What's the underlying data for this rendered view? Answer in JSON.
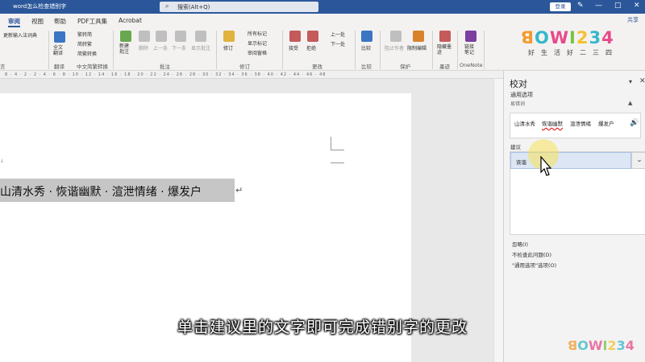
{
  "app": {
    "doc_title": "word怎么检查错别字",
    "search_placeholder": "搜索(Alt+Q)",
    "login": "登录",
    "share": "共享"
  },
  "tabs": [
    "审阅",
    "视图",
    "帮助",
    "PDF工具集",
    "Acrobat"
  ],
  "ribbon": {
    "partial_left": "更新输入法词典",
    "partial_left_label": "言",
    "translate_btn": "全文翻译",
    "trad_simp_1": "繁转简",
    "trad_simp_2": "简转繁",
    "trad_simp_3": "简繁转换",
    "group_translate": "翻译",
    "group_chinese": "中文简繁转换",
    "new_comment": "新建批注",
    "delete": "删除",
    "prev": "上一条",
    "next": "下一条",
    "show_comments": "显示批注",
    "group_comments": "批注",
    "revise": "修订",
    "all_marks": "所有标记",
    "show_marks": "显示标记",
    "review_pane": "审阅窗格",
    "group_tracking": "修订",
    "accept": "接受",
    "reject": "拒绝",
    "prev_change": "上一处",
    "next_change": "下一处",
    "group_changes": "更改",
    "compare": "比较",
    "group_compare": "比较",
    "block_authors": "阻止作者",
    "restrict_editing": "限制编辑",
    "group_protect": "保护",
    "hide_ink": "隐藏墨迹",
    "group_ink": "墨迹",
    "linked_notes": "链接笔记",
    "group_onenote": "OneNote"
  },
  "logo": {
    "big": "ꓭOWI234",
    "small": "好生活好二三四",
    "letters": [
      {
        "ch": "ꓭ",
        "color": "#f29b2f"
      },
      {
        "ch": "O",
        "color": "#35b7c9"
      },
      {
        "ch": "W",
        "color": "#e84a8a"
      },
      {
        "ch": "I",
        "color": "#7ac143"
      },
      {
        "ch": "2",
        "color": "#f5c12e"
      },
      {
        "ch": "3",
        "color": "#35b7c9"
      },
      {
        "ch": "4",
        "color": "#e84a8a"
      }
    ]
  },
  "document": {
    "text": "山清水秀 · 恢谐幽默 · 渲泄情绪 · 爆发户",
    "paragraph_mark": "↵"
  },
  "subtitle": "单击建议里的文字即可完成错别字的更改",
  "pane": {
    "title": "校对",
    "section": "通用选项",
    "subsection": "易错词",
    "context_words": [
      "山清水秀",
      "恢谐幽默",
      "渲泄情绪",
      "爆发户"
    ],
    "suggestion_label": "建议",
    "suggestion": "诙谐",
    "actions": [
      "忽略(I)",
      "不检查此问题(D)",
      "\"通用选项\"选项(O)"
    ]
  }
}
